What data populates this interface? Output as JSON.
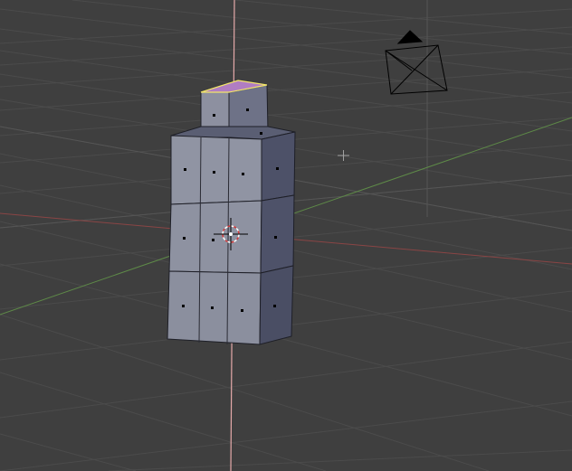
{
  "viewport": {
    "background": "#3f3f3f",
    "grid_color": "#4a4a4a",
    "grid_major_color": "#515151",
    "x_axis_color": "#8a4a4a",
    "y_axis_color": "#5a8a4a",
    "z_axis_color": "#e8b0b0",
    "mesh_face_light": "#8f93a2",
    "mesh_face_mid": "#7a7e8f",
    "mesh_face_dark": "#4c5066",
    "selected_face_color": "#b07dc2",
    "selected_edge_color": "#f3e66a"
  },
  "scene": {
    "object_icon": "mesh-object",
    "camera_icon": "camera-icon",
    "cursor_icon": "3d-cursor-icon",
    "lamp_icon": "lamp-marker-icon"
  }
}
